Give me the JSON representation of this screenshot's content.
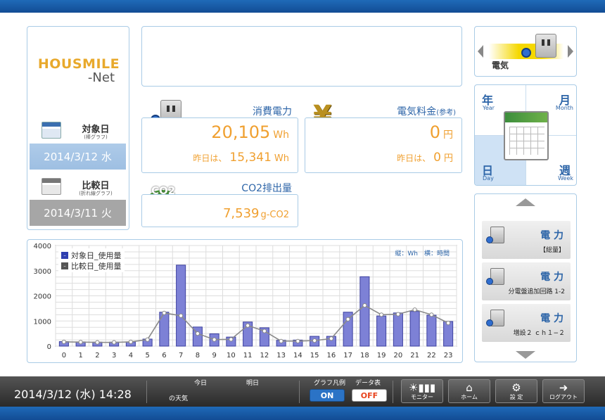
{
  "logo": {
    "main": "HOUSMILE",
    "sub": "-Net"
  },
  "dates": {
    "target_label": "対象日",
    "target_sublabel": "(棒グラフ)",
    "target_value": "2014/3/12 水",
    "compare_label": "比較日",
    "compare_sublabel": "(折れ線グラフ)",
    "compare_value": "2014/3/11 火"
  },
  "power": {
    "title": "消費電力",
    "value": "20,105",
    "unit": "Wh",
    "yesterday_prefix": "昨日は、",
    "yesterday_value": "15,341",
    "yesterday_unit": "Wh"
  },
  "fee": {
    "title": "電気料金",
    "title_note": "(参考)",
    "value": "0",
    "unit": "円",
    "yesterday_prefix": "昨日は、",
    "yesterday_value": "0",
    "yesterday_unit": "円"
  },
  "co2": {
    "title": "CO2排出量",
    "icon_text": "CO2",
    "value": "7,539",
    "unit": "g-CO2"
  },
  "energy_selector": {
    "label": "電気"
  },
  "period": {
    "year": {
      "kanji": "年",
      "eng": "Year"
    },
    "month": {
      "kanji": "月",
      "eng": "Month"
    },
    "day": {
      "kanji": "日",
      "eng": "Day"
    },
    "week": {
      "kanji": "週",
      "eng": "Week"
    }
  },
  "circuits": [
    {
      "title": "電 力",
      "sub": "【総量】"
    },
    {
      "title": "電 力",
      "sub": "分電盤追加回路 1-2"
    },
    {
      "title": "電 力",
      "sub": "増設２ ｃｈ１−２"
    }
  ],
  "chart_data": {
    "type": "bar",
    "categories": [
      "0",
      "1",
      "2",
      "3",
      "4",
      "5",
      "6",
      "7",
      "8",
      "9",
      "10",
      "11",
      "12",
      "13",
      "14",
      "15",
      "16",
      "17",
      "18",
      "19",
      "20",
      "21",
      "22",
      "23"
    ],
    "series": [
      {
        "name": "対象日_使用量",
        "type": "bar",
        "values": [
          180,
          170,
          160,
          160,
          170,
          280,
          1350,
          3220,
          760,
          490,
          360,
          960,
          730,
          230,
          240,
          390,
          390,
          1350,
          2760,
          1200,
          1320,
          1380,
          1230,
          980
        ]
      },
      {
        "name": "比較日_使用量",
        "type": "line",
        "values": [
          170,
          160,
          150,
          150,
          170,
          260,
          1320,
          1210,
          500,
          260,
          270,
          820,
          600,
          200,
          200,
          220,
          300,
          1070,
          1620,
          1250,
          1270,
          1450,
          1250,
          920
        ]
      }
    ],
    "ylim": [
      0,
      4000
    ],
    "yticks": [
      0,
      1000,
      2000,
      3000,
      4000
    ],
    "unit_note": "縦：Wh　横：時間",
    "grid": true,
    "legend_position": "top-left",
    "colors": {
      "bar_fill": "#7d81d6",
      "bar_stroke": "#3e42a0",
      "line": "#8a8a8a",
      "point": "#ffffff",
      "legend_target": "#2f3fb0",
      "legend_compare": "#555555"
    }
  },
  "status": {
    "datetime": "2014/3/12 (水) 14:28",
    "today": "今日",
    "tomorrow": "明日",
    "weather_label": "の天気",
    "legend_toggle_label": "グラフ凡例",
    "legend_toggle": "ON",
    "table_toggle_label": "データ表",
    "table_toggle": "OFF",
    "nav": [
      "モニター",
      "ホーム",
      "設 定",
      "ログアウト"
    ]
  }
}
